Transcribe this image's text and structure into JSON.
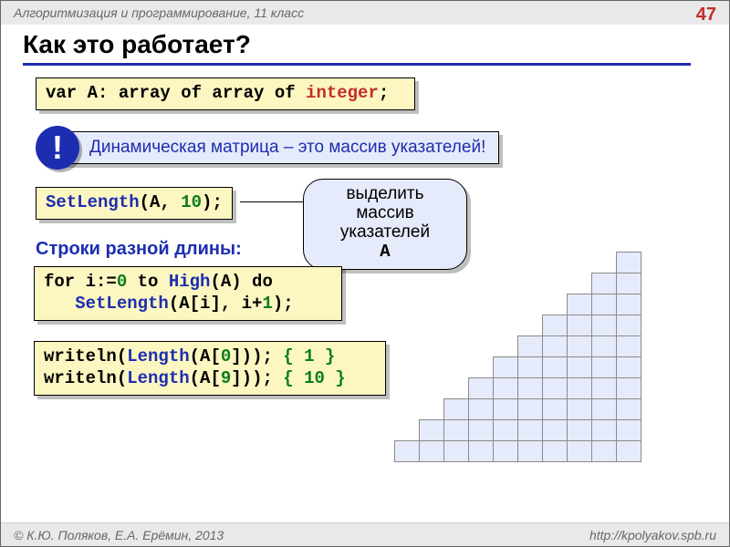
{
  "header": {
    "course": "Алгоритмизация и программирование, 11 класс",
    "page": "47"
  },
  "title": "Как это работает?",
  "code_decl": {
    "pre": "var A: array of array of ",
    "type": "integer",
    "post": ";"
  },
  "bang": {
    "icon": "!",
    "text": "Динамическая матрица – это  массив указателей!"
  },
  "code_setlen": {
    "fn": "SetLength",
    "open": "(A, ",
    "n": "10",
    "close": ");"
  },
  "callout": {
    "l1": "выделить",
    "l2": "массив",
    "l3": "указателей",
    "l4": "A"
  },
  "subhead": "Строки разной длины:",
  "code_loop": {
    "a": "for i:=",
    "zero": "0",
    "b": " to ",
    "high": "High",
    "c": "(A) do",
    "indent": "   ",
    "fn": "SetLength",
    "open2": "(A[i], i+",
    "one": "1",
    "close2": ");"
  },
  "code_out": {
    "l1a": "writeln(",
    "len": "Length",
    "l1b": "(A[",
    "z0": "0",
    "l1c": "])); ",
    "c1": "{ 1 }",
    "l2a": "writeln(",
    "l2b": "(A[",
    "z9": "9",
    "l2c": "])); ",
    "c2": "{ 10 }"
  },
  "footer": {
    "left": "© К.Ю. Поляков, Е.А. Ерёмин, 2013",
    "right": "http://kpolyakov.spb.ru"
  },
  "stair": {
    "rows": 10
  }
}
